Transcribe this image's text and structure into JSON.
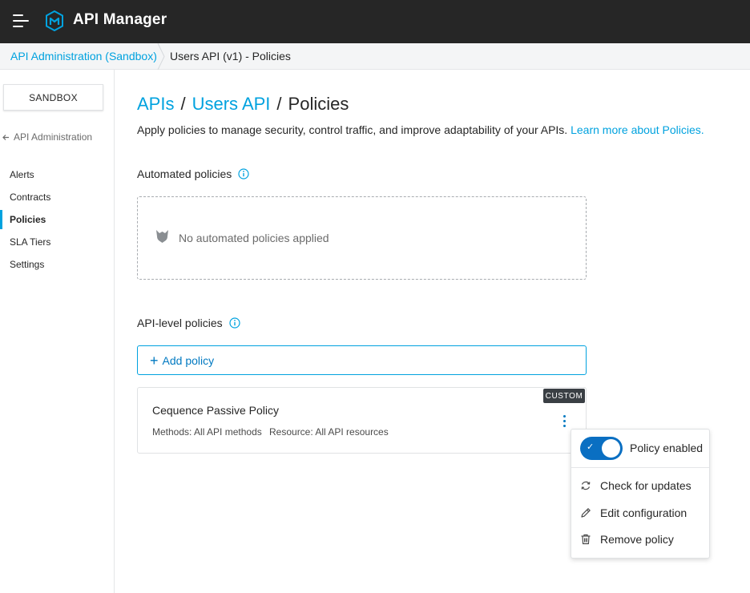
{
  "header": {
    "app_title": "API Manager"
  },
  "breadcrumb": {
    "parent": "API Administration (Sandbox)",
    "current": "Users API (v1) - Policies"
  },
  "sidebar": {
    "environment": "SANDBOX",
    "back_label": "API Administration",
    "items": [
      {
        "label": "Alerts",
        "active": false
      },
      {
        "label": "Contracts",
        "active": false
      },
      {
        "label": "Policies",
        "active": true
      },
      {
        "label": "SLA Tiers",
        "active": false
      },
      {
        "label": "Settings",
        "active": false
      }
    ]
  },
  "page": {
    "title_apis": "APIs",
    "title_api": "Users API",
    "title_current": "Policies",
    "title_separator": "/",
    "description": "Apply policies to manage security, control traffic, and improve adaptability of your APIs.",
    "learn_more": "Learn more about Policies."
  },
  "automated": {
    "heading": "Automated policies",
    "empty_text": "No automated policies applied"
  },
  "api_level": {
    "heading": "API-level policies",
    "add_label": "Add policy",
    "policy": {
      "badge": "CUSTOM",
      "name": "Cequence Passive Policy",
      "methods": "Methods: All API methods",
      "resource": "Resource: All API resources"
    }
  },
  "menu": {
    "toggle_label": "Policy enabled",
    "toggle_on": true,
    "items": [
      {
        "label": "Check for updates",
        "icon": "refresh-icon"
      },
      {
        "label": "Edit configuration",
        "icon": "pencil-icon"
      },
      {
        "label": "Remove policy",
        "icon": "trash-icon"
      }
    ]
  },
  "colors": {
    "accent": "#00a2df",
    "link_dark": "#0079c1",
    "header_bg": "#262626",
    "toggle": "#0a6fc2"
  }
}
